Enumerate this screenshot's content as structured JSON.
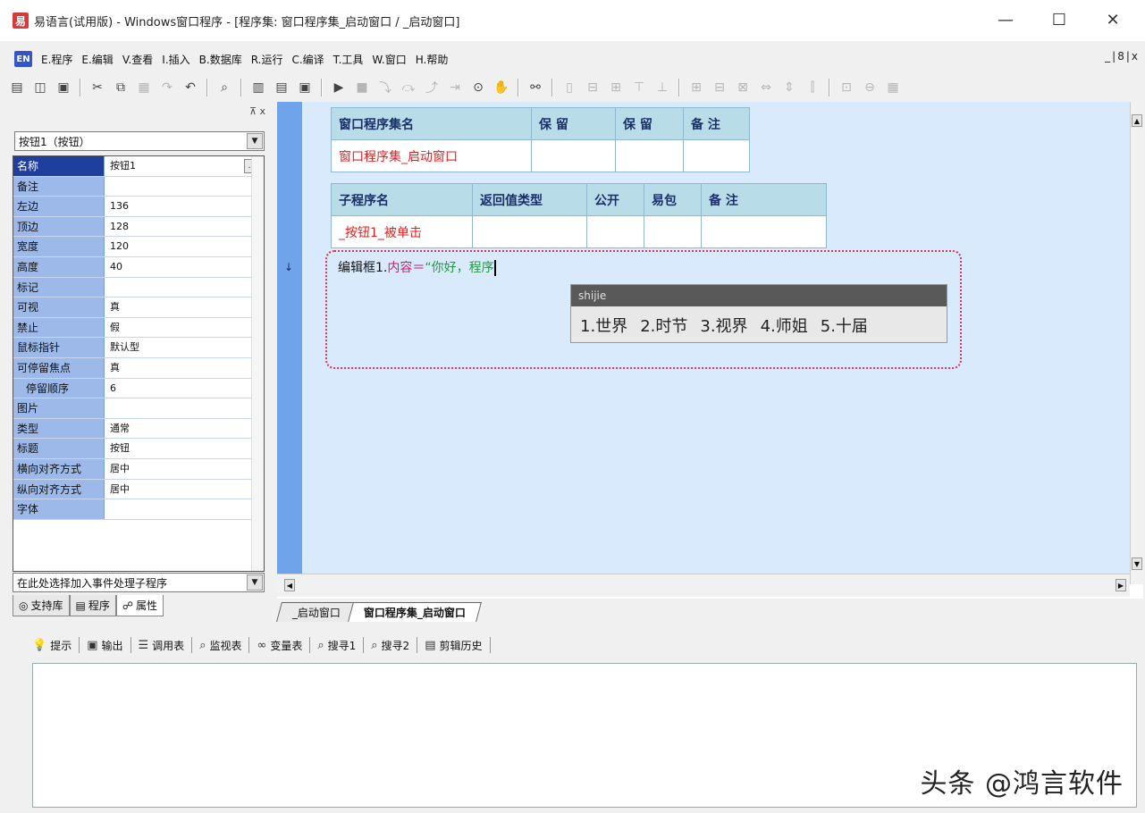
{
  "window": {
    "title": "易语言(试用版) - Windows窗口程序 - [程序集: 窗口程序集_启动窗口 / _启动窗口]",
    "minimize_glyph": "—",
    "maximize_glyph": "☐",
    "close_glyph": "✕"
  },
  "menu": {
    "items": [
      "E.程序",
      "E.编辑",
      "V.查看",
      "I.插入",
      "B.数据库",
      "R.运行",
      "C.编译",
      "T.工具",
      "W.窗口",
      "H.帮助"
    ],
    "mdi_controls": "_|8|x"
  },
  "left_panel": {
    "pin_label": "⊼ x",
    "object_selector": "按钮1（按钮）",
    "properties": [
      {
        "name": "名称",
        "value": "按钮1",
        "selected": true,
        "has_button": true
      },
      {
        "name": "备注",
        "value": ""
      },
      {
        "name": "左边",
        "value": "136"
      },
      {
        "name": "顶边",
        "value": "128"
      },
      {
        "name": "宽度",
        "value": "120"
      },
      {
        "name": "高度",
        "value": "40"
      },
      {
        "name": "标记",
        "value": ""
      },
      {
        "name": "可视",
        "value": "真"
      },
      {
        "name": "禁止",
        "value": "假"
      },
      {
        "name": "鼠标指针",
        "value": "默认型"
      },
      {
        "name": "可停留焦点",
        "value": "真"
      },
      {
        "name": "停留顺序",
        "value": "6",
        "sub": true
      },
      {
        "name": "图片",
        "value": ""
      },
      {
        "name": "类型",
        "value": "通常"
      },
      {
        "name": "标题",
        "value": "按钮"
      },
      {
        "name": "横向对齐方式",
        "value": "居中"
      },
      {
        "name": "纵向对齐方式",
        "value": "居中"
      },
      {
        "name": "字体",
        "value": ""
      }
    ],
    "event_selector": "在此处选择加入事件处理子程序",
    "tabs": [
      {
        "label": "支持库",
        "icon": "globe-icon"
      },
      {
        "label": "程序",
        "icon": "program-icon"
      },
      {
        "label": "属性",
        "icon": "property-icon",
        "active": true
      }
    ]
  },
  "editor": {
    "assembly_table": {
      "headers": [
        "窗口程序集名",
        "保 留",
        "保 留",
        "备 注"
      ],
      "row": [
        "窗口程序集_启动窗口",
        "",
        "",
        ""
      ]
    },
    "sub_table": {
      "headers": [
        "子程序名",
        "返回值类型",
        "公开",
        "易包",
        "备 注"
      ],
      "row": [
        "_按钮1_被单击",
        "",
        "",
        "",
        ""
      ]
    },
    "code_line": {
      "object": "编辑框1.",
      "property": "内容",
      "equals": "＝",
      "string": "“你好，程序"
    },
    "gutter_marker": "↓",
    "ime": {
      "header": "shijie",
      "candidates": [
        "1.世界",
        "2.时节",
        "3.视界",
        "4.师姐",
        "5.十届"
      ]
    },
    "doc_tabs": [
      "_启动窗口",
      "窗口程序集_启动窗口"
    ]
  },
  "bottom_panel": {
    "tabs": [
      {
        "label": "提示",
        "icon": "bulb-icon"
      },
      {
        "label": "输出",
        "icon": "output-icon"
      },
      {
        "label": "调用表",
        "icon": "callstack-icon"
      },
      {
        "label": "监视表",
        "icon": "magnifier-icon"
      },
      {
        "label": "变量表",
        "icon": "variables-icon"
      },
      {
        "label": "搜寻1",
        "icon": "search1-icon"
      },
      {
        "label": "搜寻2",
        "icon": "search2-icon"
      },
      {
        "label": "剪辑历史",
        "icon": "clip-history-icon"
      }
    ]
  },
  "watermark": "头条 @鸿言软件"
}
